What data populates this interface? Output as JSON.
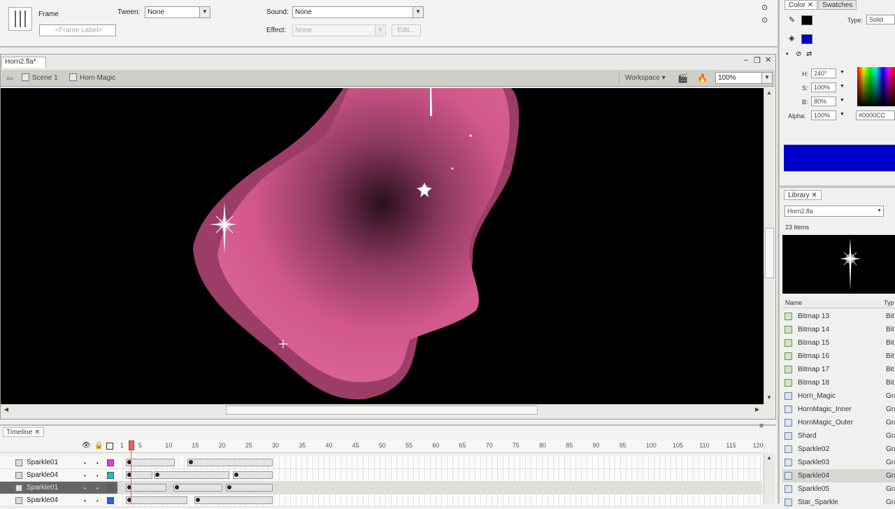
{
  "properties": {
    "frame_label": "Frame",
    "frame_placeholder": "<Frame Label>",
    "tween_label": "Tween:",
    "tween_value": "None",
    "sound_label": "Sound:",
    "sound_value": "None",
    "effect_label": "Effect:",
    "effect_value": "None",
    "edit_button": "Edit..."
  },
  "document": {
    "tab": "Horn2.fla*",
    "scene": "Scene 1",
    "symbol": "Horn Magic",
    "workspace": "Workspace",
    "zoom": "100%"
  },
  "timeline": {
    "tab": "Timeline",
    "frame_ticks": [
      "1",
      "5",
      "10",
      "15",
      "20",
      "25",
      "30",
      "35",
      "40",
      "45",
      "50",
      "55",
      "60",
      "65",
      "70",
      "75",
      "80",
      "85",
      "90",
      "95",
      "100",
      "105",
      "110",
      "115",
      "120"
    ],
    "layers": [
      {
        "name": "Sparkle01",
        "color": "#e040e0"
      },
      {
        "name": "Sparkle04",
        "color": "#20c0c0"
      },
      {
        "name": "Sparkle01",
        "color": "#606060"
      },
      {
        "name": "Sparkle04",
        "color": "#3060e0"
      }
    ]
  },
  "color_panel": {
    "tab_color": "Color",
    "tab_swatches": "Swatches",
    "type_label": "Type:",
    "type_value": "Solid",
    "h_label": "H:",
    "h_value": "240°",
    "s_label": "S:",
    "s_value": "100%",
    "b_label": "B:",
    "b_value": "80%",
    "alpha_label": "Alpha:",
    "alpha_value": "100%",
    "hex_value": "#0000CC",
    "fill_color": "#0000cc"
  },
  "library": {
    "tab": "Library",
    "document": "Horn2.fla",
    "count": "23 items",
    "col_name": "Name",
    "col_type": "Typ",
    "items": [
      {
        "name": "Bitmap 13",
        "type": "Bit",
        "kind": "bitmap"
      },
      {
        "name": "Bitmap 14",
        "type": "Bit",
        "kind": "bitmap"
      },
      {
        "name": "Bitmap 15",
        "type": "Bit",
        "kind": "bitmap"
      },
      {
        "name": "Bitmap 16",
        "type": "Bit",
        "kind": "bitmap"
      },
      {
        "name": "Bitmap 17",
        "type": "Bit",
        "kind": "bitmap"
      },
      {
        "name": "Bitmap 18",
        "type": "Bit",
        "kind": "bitmap"
      },
      {
        "name": "Horn_Magic",
        "type": "Gra",
        "kind": "graphic"
      },
      {
        "name": "HornMagic_Inner",
        "type": "Gra",
        "kind": "graphic"
      },
      {
        "name": "HornMagic_Outer",
        "type": "Gra",
        "kind": "graphic"
      },
      {
        "name": "Shard",
        "type": "Gra",
        "kind": "graphic"
      },
      {
        "name": "Sparkle02",
        "type": "Gra",
        "kind": "graphic"
      },
      {
        "name": "Sparkle03",
        "type": "Gra",
        "kind": "graphic"
      },
      {
        "name": "Sparkle04",
        "type": "Gra",
        "kind": "graphic"
      },
      {
        "name": "Sparkle05",
        "type": "Gra",
        "kind": "graphic"
      },
      {
        "name": "Star_Sparkle",
        "type": "Gra",
        "kind": "graphic"
      }
    ]
  }
}
